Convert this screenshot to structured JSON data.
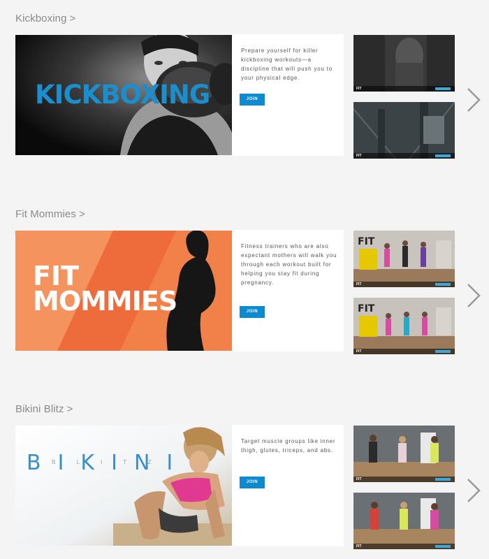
{
  "sections": [
    {
      "title": "Kickboxing",
      "chevron": ">",
      "hero_text": "KICKBOXING",
      "description": "Prepare yourself for killer kickboxing workouts—a discipline that will push you to your physical edge.",
      "join_label": "JOIN",
      "thumb_logo": "FIT"
    },
    {
      "title": "Fit Mommies",
      "chevron": ">",
      "hero_line1": "FIT",
      "hero_line2": "MOMMIES",
      "description": "Fitness trainers who are also expectant mothers will walk you through each workout built for helping you stay fit during pregnancy.",
      "join_label": "JOIN",
      "thumb_logo": "FIT"
    },
    {
      "title": "Bikini Blitz",
      "chevron": ">",
      "hero_text": "BIKINI",
      "hero_sub": "BLITZ",
      "description": "Target muscle groups like inner thigh, glutes, triceps, and abs.",
      "join_label": "JOIN",
      "thumb_logo": "FIT"
    }
  ],
  "colors": {
    "accent": "#0e8bd0",
    "kick_text": "#1a8fd0",
    "orange": "#f07a43"
  }
}
